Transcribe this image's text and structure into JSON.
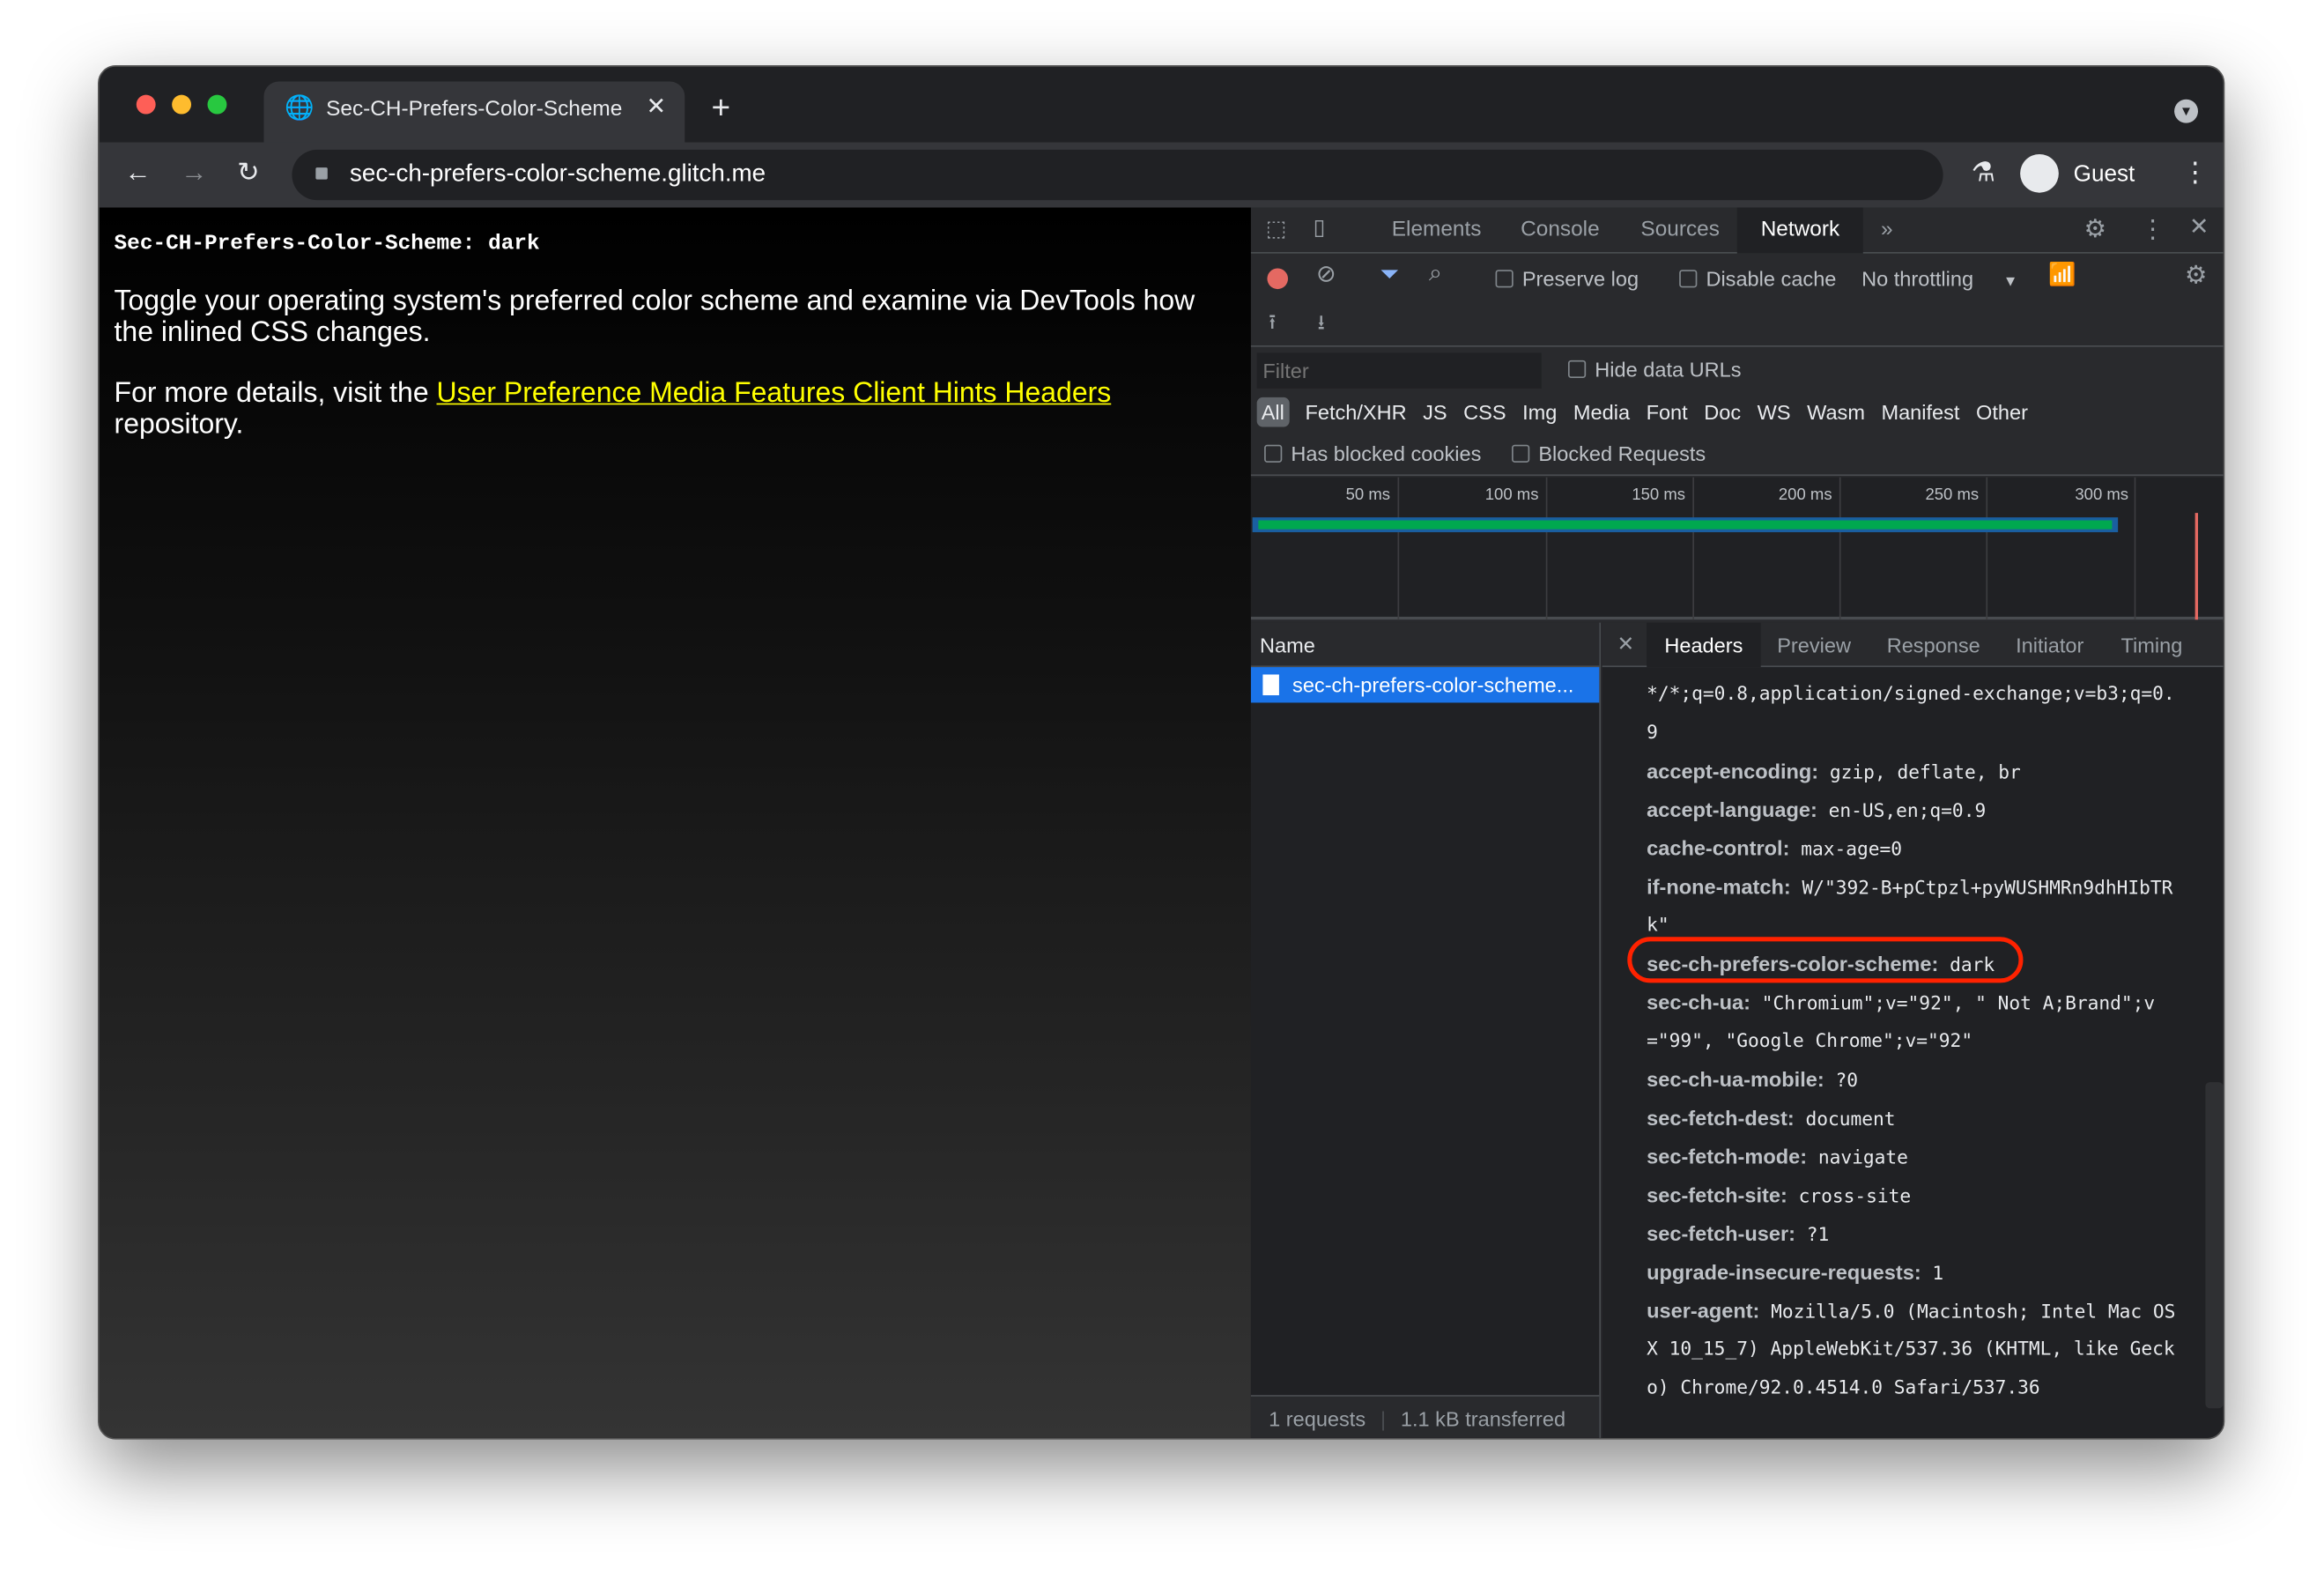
{
  "browser": {
    "tab_title": "Sec-CH-Prefers-Color-Scheme",
    "url": "sec-ch-prefers-color-scheme.glitch.me",
    "profile": "Guest"
  },
  "page": {
    "header_line": "Sec-CH-Prefers-Color-Scheme: dark",
    "p1": "Toggle your operating system's preferred color scheme and examine via DevTools how the inlined CSS changes.",
    "p2_prefix": "For more details, visit the ",
    "p2_link": "User Preference Media Features Client Hints Headers",
    "p2_suffix": " repository."
  },
  "devtools": {
    "tabs": [
      "Elements",
      "Console",
      "Sources",
      "Network"
    ],
    "active_tab": "Network",
    "preserve_log": "Preserve log",
    "disable_cache": "Disable cache",
    "throttling": "No throttling",
    "filter_placeholder": "Filter",
    "hide_data_urls": "Hide data URLs",
    "types": [
      "All",
      "Fetch/XHR",
      "JS",
      "CSS",
      "Img",
      "Media",
      "Font",
      "Doc",
      "WS",
      "Wasm",
      "Manifest",
      "Other"
    ],
    "has_blocked_cookies": "Has blocked cookies",
    "blocked_requests": "Blocked Requests",
    "timeline_ticks": [
      "50 ms",
      "100 ms",
      "150 ms",
      "200 ms",
      "250 ms",
      "300 ms"
    ],
    "name_header": "Name",
    "request_name": "sec-ch-prefers-color-scheme...",
    "detail_tabs": [
      "Headers",
      "Preview",
      "Response",
      "Initiator",
      "Timing"
    ],
    "header_lines": [
      {
        "k": "",
        "v": "*/*;q=0.8,application/signed-exchange;v=b3;q=0."
      },
      {
        "k": "",
        "v": "9"
      },
      {
        "k": "accept-encoding:",
        "v": " gzip, deflate, br"
      },
      {
        "k": "accept-language:",
        "v": " en-US,en;q=0.9"
      },
      {
        "k": "cache-control:",
        "v": " max-age=0"
      },
      {
        "k": "if-none-match:",
        "v": " W/\"392-B+pCtpzl+pyWUSHMRn9dhHIbTR"
      },
      {
        "k": "",
        "v": "k\""
      },
      {
        "k": "sec-ch-prefers-color-scheme:",
        "v": " dark"
      },
      {
        "k": "sec-ch-ua:",
        "v": " \"Chromium\";v=\"92\", \" Not A;Brand\";v"
      },
      {
        "k": "",
        "v": "=\"99\", \"Google Chrome\";v=\"92\""
      },
      {
        "k": "sec-ch-ua-mobile:",
        "v": " ?0"
      },
      {
        "k": "sec-fetch-dest:",
        "v": " document"
      },
      {
        "k": "sec-fetch-mode:",
        "v": " navigate"
      },
      {
        "k": "sec-fetch-site:",
        "v": " cross-site"
      },
      {
        "k": "sec-fetch-user:",
        "v": " ?1"
      },
      {
        "k": "upgrade-insecure-requests:",
        "v": " 1"
      },
      {
        "k": "user-agent:",
        "v": " Mozilla/5.0 (Macintosh; Intel Mac OS"
      },
      {
        "k": "",
        "v": "X 10_15_7) AppleWebKit/537.36 (KHTML, like Geck"
      },
      {
        "k": "",
        "v": "o) Chrome/92.0.4514.0 Safari/537.36"
      }
    ],
    "highlighted_header": "sec-ch-prefers-color-scheme",
    "status_requests": "1 requests",
    "status_transferred": "1.1 kB transferred"
  },
  "colors": {
    "link": "#ffff00",
    "highlight": "#ff2200",
    "waterfall": "#00a84f",
    "accent": "#8ab4f8"
  }
}
